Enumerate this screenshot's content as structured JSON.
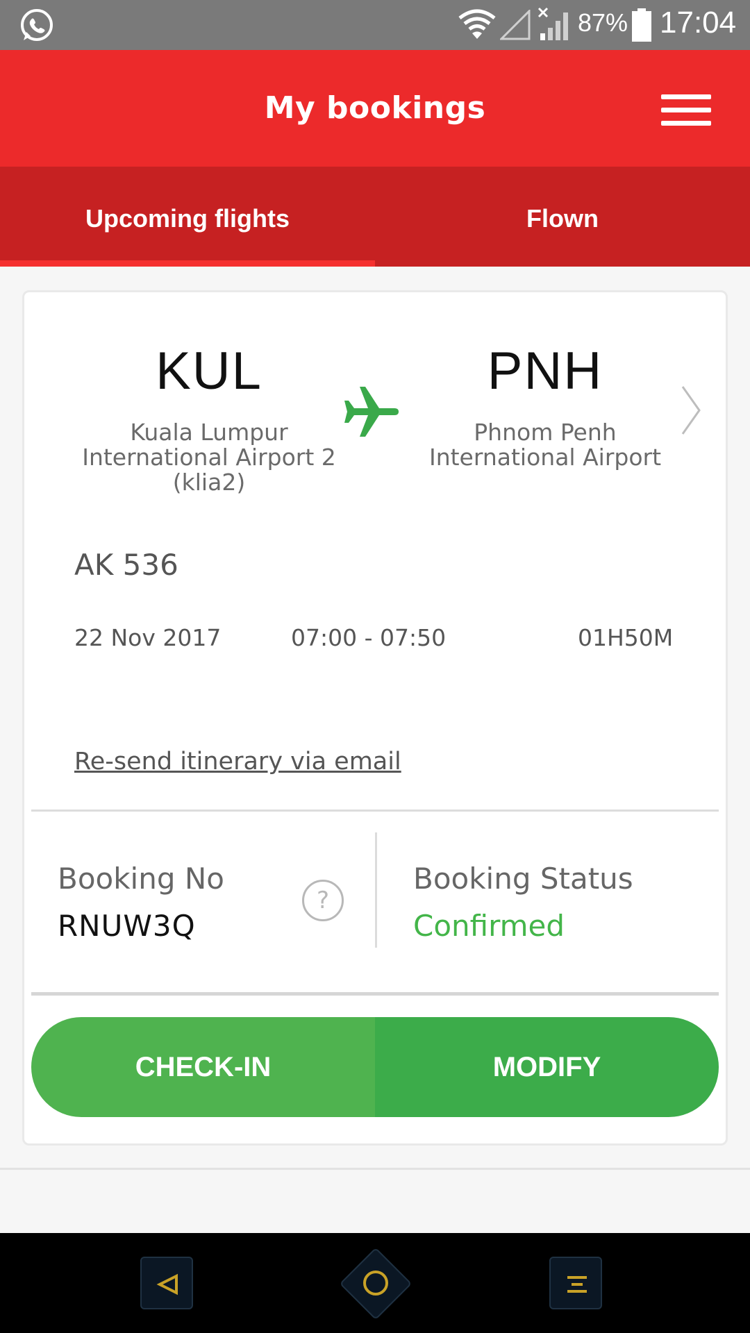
{
  "status_bar": {
    "battery_percent": "87%",
    "time": "17:04",
    "icons": [
      "whatsapp-icon",
      "wifi-icon",
      "signal-icon",
      "no-signal-icon",
      "battery-icon"
    ]
  },
  "app_bar": {
    "title": "My bookings",
    "menu_icon": "hamburger-menu-icon"
  },
  "tabs": [
    {
      "label": "Upcoming flights",
      "selected": true
    },
    {
      "label": "Flown",
      "selected": false
    }
  ],
  "booking": {
    "origin": {
      "code": "KUL",
      "airport": "Kuala Lumpur International Airport 2 (klia2)"
    },
    "destination": {
      "code": "PNH",
      "airport": "Phnom Penh International Airport"
    },
    "plane_icon": "plane-icon",
    "flight_no": "AK 536",
    "date": "22 Nov 2017",
    "times": "07:00 - 07:50",
    "duration": "01H50M",
    "resend_link": "Re-send itinerary via email",
    "booking_no_label": "Booking No",
    "booking_no": "RNUW3Q",
    "help_glyph": "?",
    "status_label": "Booking Status",
    "status_value": "Confirmed",
    "checkin_label": "CHECK-IN",
    "modify_label": "MODIFY"
  },
  "colors": {
    "brand_red": "#ec2a2b",
    "tab_red": "#c62122",
    "confirmed_green": "#43b549",
    "button_green": "#4fb34f",
    "plane_green": "#3aa94a"
  },
  "nav_bar": {
    "icons": [
      "back-icon",
      "home-icon",
      "recent-apps-icon"
    ]
  }
}
